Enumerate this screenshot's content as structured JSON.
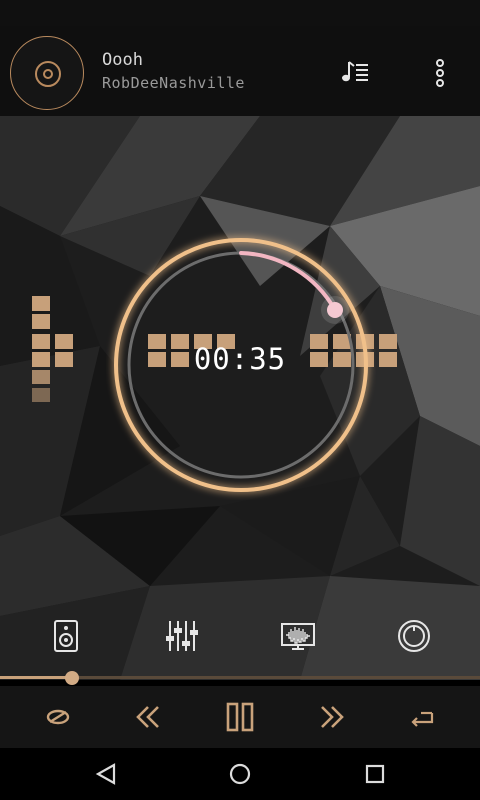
{
  "track": {
    "title": "Oooh",
    "artist": "RobDeeNashville"
  },
  "player": {
    "elapsed_time": "00:35",
    "seek_progress": 0.15
  },
  "icons": {
    "album_art": "disc-icon",
    "playlist": "playlist-icon",
    "overflow": "more-vertical-icon",
    "speaker": "speaker-icon",
    "equalizer": "equalizer-sliders-icon",
    "visualizer": "waveform-monitor-icon",
    "bass": "knob-icon",
    "shuffle": "shuffle-icon",
    "previous": "rewind-icon",
    "pause": "pause-icon",
    "next": "fast-forward-icon",
    "repeat": "repeat-icon",
    "nav_back": "back-triangle-icon",
    "nav_home": "home-circle-icon",
    "nav_recents": "recents-square-icon"
  },
  "colors": {
    "accent": "#c9a27b",
    "ring_glow": "#f0c08a",
    "progress_arc": "#f2b6c2"
  }
}
